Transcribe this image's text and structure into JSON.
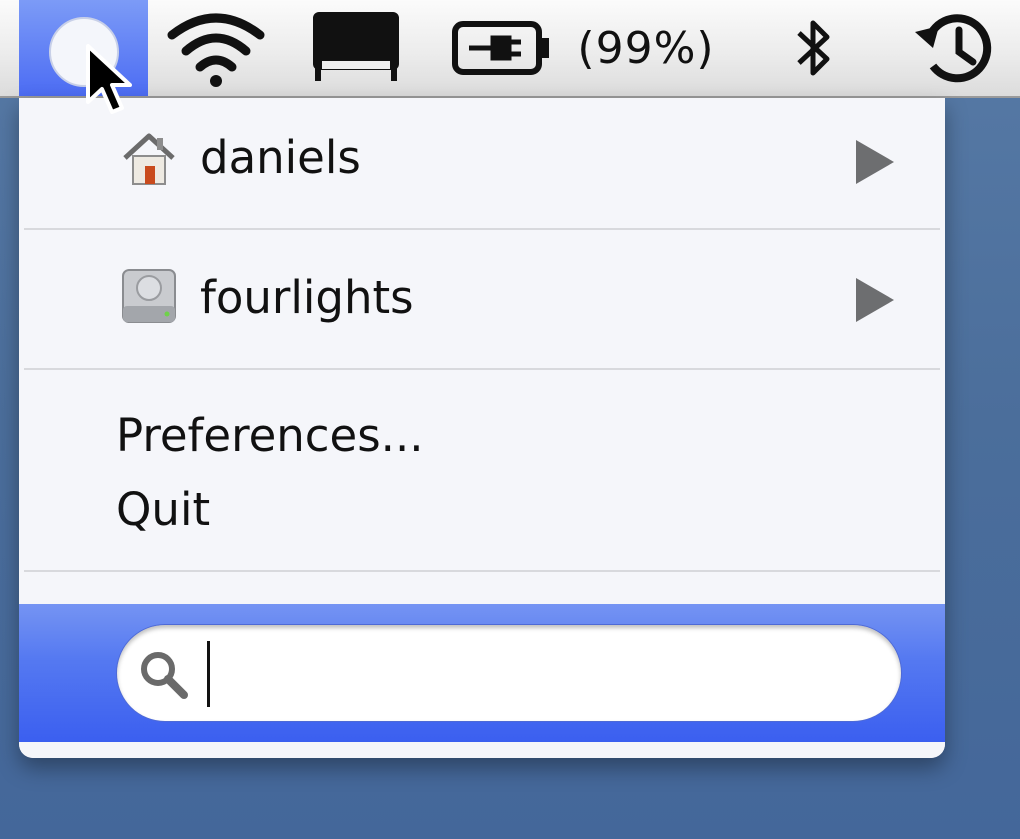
{
  "menubar": {
    "battery_percent": "(99%)",
    "items": [
      "status-menu-icon",
      "wifi-icon",
      "display-icon",
      "battery-icon",
      "bluetooth-icon",
      "time-machine-icon"
    ]
  },
  "menu": {
    "items": [
      {
        "label": "daniels",
        "icon": "home-folder-icon",
        "has_submenu": true
      },
      {
        "label": "fourlights",
        "icon": "hard-drive-icon",
        "has_submenu": true
      }
    ],
    "preferences_label": "Preferences...",
    "quit_label": "Quit"
  },
  "search": {
    "value": "",
    "placeholder": ""
  },
  "colors": {
    "highlight": "#4c6cf3",
    "menu_bg": "#f5f6fa",
    "desktop": "#4a6f9e"
  }
}
